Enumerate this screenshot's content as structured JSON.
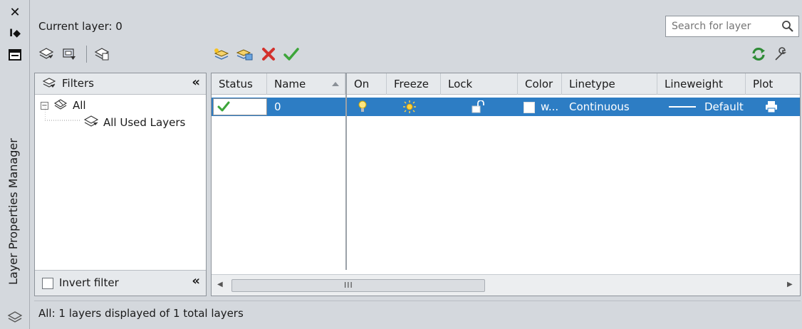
{
  "window": {
    "title": "Layer Properties Manager"
  },
  "header": {
    "current_layer": "Current layer: 0",
    "search_placeholder": "Search for layer"
  },
  "filters": {
    "header_label": "Filters",
    "tree": [
      {
        "label": "All"
      },
      {
        "label": "All Used Layers"
      }
    ],
    "invert_filter_label": "Invert filter"
  },
  "table": {
    "columns": [
      "Status",
      "Name",
      "On",
      "Freeze",
      "Lock",
      "Color",
      "Linetype",
      "Lineweight",
      "Plot"
    ],
    "rows": [
      {
        "name": "0",
        "color_label": "w...",
        "linetype": "Continuous",
        "lineweight": "Default"
      }
    ],
    "scroll_grip": "III"
  },
  "status": {
    "text": "All: 1 layers displayed of 1 total layers"
  },
  "colors": {
    "selection": "#2d7dc4",
    "panel_bg": "#d4d8dd",
    "header_bg": "#e6e9ec"
  },
  "icons": {
    "toolbar_left": [
      "new-property-filter-icon",
      "new-group-filter-icon",
      "layer-states-manager-icon"
    ],
    "toolbar_mid": [
      "new-layer-icon",
      "new-layer-vp-frozen-icon",
      "delete-layer-icon",
      "set-current-icon"
    ],
    "toolbar_right": [
      "refresh-icon",
      "settings-icon"
    ]
  }
}
